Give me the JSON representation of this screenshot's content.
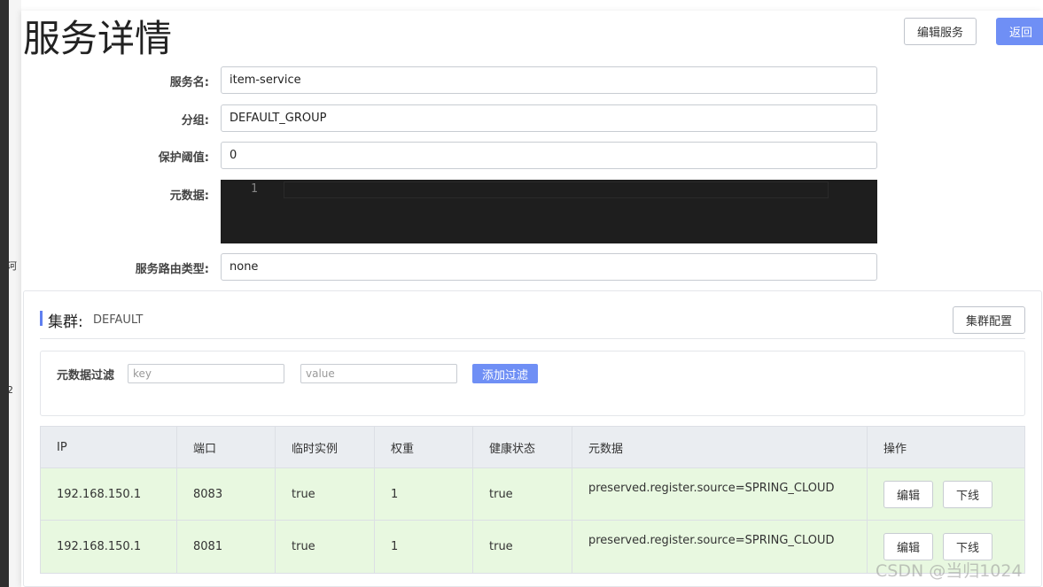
{
  "page": {
    "title": "服务详情",
    "edit_service_label": "编辑服务",
    "back_label": "返回"
  },
  "edge": {
    "char_1": "河",
    "char_2": "2"
  },
  "form": {
    "service_name_label": "服务名:",
    "service_name_value": "item-service",
    "group_label": "分组:",
    "group_value": "DEFAULT_GROUP",
    "threshold_label": "保护阈值:",
    "threshold_value": "0",
    "metadata_label": "元数据:",
    "metadata_line_number": "1",
    "router_label": "服务路由类型:",
    "router_value": "none"
  },
  "cluster": {
    "title": "集群:",
    "name": "DEFAULT",
    "config_label": "集群配置",
    "filter_label": "元数据过滤",
    "key_placeholder": "key",
    "value_placeholder": "value",
    "add_filter_label": "添加过滤"
  },
  "table": {
    "headers": [
      "IP",
      "端口",
      "临时实例",
      "权重",
      "健康状态",
      "元数据",
      "操作"
    ],
    "rows": [
      {
        "ip": "192.168.150.1",
        "port": "8083",
        "ephemeral": "true",
        "weight": "1",
        "healthy": "true",
        "metadata": "preserved.register.source=SPRING_CLOUD",
        "edit": "编辑",
        "offline": "下线"
      },
      {
        "ip": "192.168.150.1",
        "port": "8081",
        "ephemeral": "true",
        "weight": "1",
        "healthy": "true",
        "metadata": "preserved.register.source=SPRING_CLOUD",
        "edit": "编辑",
        "offline": "下线"
      }
    ]
  },
  "watermark": "CSDN @当归1024",
  "colors": {
    "primary": "#6f8ff5",
    "row_green": "#e8f8e0",
    "header_gray": "#eaedf1",
    "editor_bg": "#1e1e1e"
  }
}
